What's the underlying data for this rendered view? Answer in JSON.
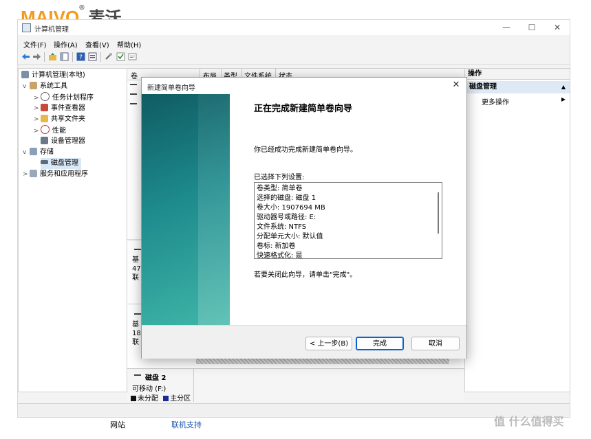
{
  "logo": {
    "brand": "MAIVO",
    "reg": "®",
    "cn": "麦沃"
  },
  "window": {
    "title": "计算机管理",
    "min": "—",
    "max": "☐",
    "close": "✕"
  },
  "menu": [
    "文件(F)",
    "操作(A)",
    "查看(V)",
    "帮助(H)"
  ],
  "tree": [
    {
      "label": "计算机管理(本地)",
      "indent": 0,
      "chev": ""
    },
    {
      "label": "系统工具",
      "indent": 1,
      "chev": "v"
    },
    {
      "label": "任务计划程序",
      "indent": 2,
      "chev": ">"
    },
    {
      "label": "事件查看器",
      "indent": 2,
      "chev": ">"
    },
    {
      "label": "共享文件夹",
      "indent": 2,
      "chev": ">"
    },
    {
      "label": "性能",
      "indent": 2,
      "chev": ">"
    },
    {
      "label": "设备管理器",
      "indent": 2,
      "chev": ""
    },
    {
      "label": "存储",
      "indent": 1,
      "chev": "v"
    },
    {
      "label": "磁盘管理",
      "indent": 2,
      "chev": ""
    },
    {
      "label": "服务和应用程序",
      "indent": 1,
      "chev": ">"
    }
  ],
  "columns": [
    "卷",
    "布局",
    "类型",
    "文件系统",
    "状态"
  ],
  "disks": {
    "d0": [
      "基",
      "47",
      "联"
    ],
    "d1": [
      "基",
      "18",
      "联"
    ],
    "d2": {
      "name": "磁盘 2",
      "type": "可移动 (F:)"
    },
    "legend": [
      "未分配",
      "主分区"
    ]
  },
  "actions": {
    "header": "操作",
    "section": "磁盘管理",
    "more": "更多操作"
  },
  "footer": {
    "link1": "网站",
    "link2": "联机支持"
  },
  "watermark": "值 什么值得买",
  "dialog": {
    "title": "新建简单卷向导",
    "close": "✕",
    "heading": "正在完成新建简单卷向导",
    "success": "你已经成功完成新建简单卷向导。",
    "selected": "已选择下列设置:",
    "summary": [
      "卷类型: 简单卷",
      "选择的磁盘: 磁盘 1",
      "卷大小: 1907694 MB",
      "驱动器号或路径: E:",
      "文件系统: NTFS",
      "分配单元大小: 默认值",
      "卷标: 新加卷",
      "快速格式化: 是"
    ],
    "hint": "若要关闭此向导，请单击\"完成\"。",
    "back": "< 上一步(B)",
    "finish": "完成",
    "cancel": "取消"
  },
  "colors": {
    "accent": "#0a64c8",
    "banner": "#1d8a8c",
    "selection": "#d9e8f6"
  }
}
